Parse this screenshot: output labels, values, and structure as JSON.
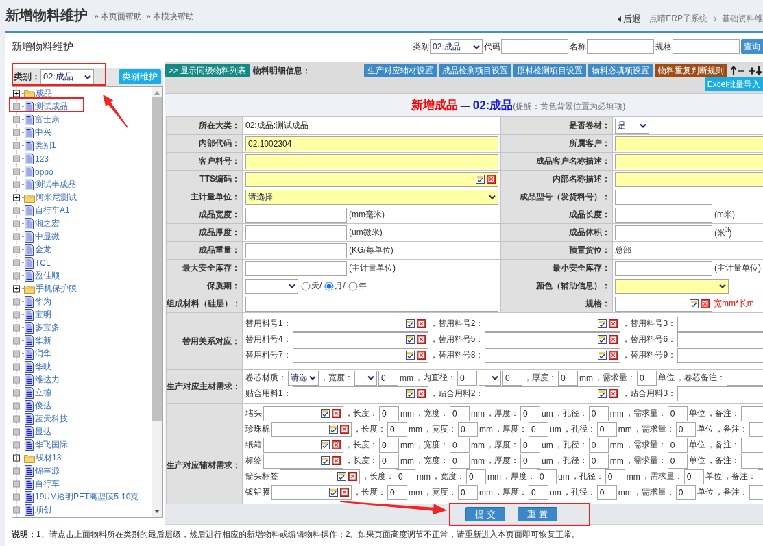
{
  "header": {
    "title": "新增物料维护",
    "links": [
      "» 本页面帮助",
      "» 本模块帮助"
    ],
    "back": "后退",
    "breadcrumb": [
      "点晴ERP子系统",
      "基础资料维"
    ]
  },
  "panel": {
    "title": "新增物料维护",
    "search": [
      {
        "kind": "select",
        "label": "类别",
        "value": "02:成品"
      },
      {
        "kind": "input",
        "label": "代码"
      },
      {
        "kind": "input",
        "label": "名称"
      },
      {
        "kind": "input",
        "label": "规格"
      }
    ],
    "search_button": "查询"
  },
  "category_filter": {
    "label": "类别：",
    "value": "02:成品",
    "button": "类别维护",
    "highlighted": true
  },
  "tree": [
    {
      "label": "成品",
      "kind": "folder",
      "expanded": false,
      "highlighted": false
    },
    {
      "label": "测试成品",
      "kind": "document",
      "highlighted": true
    },
    {
      "label": "富士康",
      "kind": "document",
      "highlighted": false
    },
    {
      "label": "中兴",
      "kind": "document",
      "highlighted": false
    },
    {
      "label": "类别1",
      "kind": "document",
      "highlighted": false
    },
    {
      "label": "123",
      "kind": "document",
      "highlighted": false
    },
    {
      "label": "oppo",
      "kind": "document",
      "highlighted": false
    },
    {
      "label": "测试半成品",
      "kind": "document",
      "highlighted": false
    },
    {
      "label": "阿米尼测试",
      "kind": "folder",
      "expanded": false,
      "highlighted": false
    },
    {
      "label": "自行车A1",
      "kind": "document",
      "highlighted": false
    },
    {
      "label": "湘之宏",
      "kind": "document",
      "highlighted": false
    },
    {
      "label": "中显微",
      "kind": "document",
      "highlighted": false
    },
    {
      "label": "金龙",
      "kind": "document",
      "highlighted": false
    },
    {
      "label": "TCL",
      "kind": "document",
      "highlighted": false
    },
    {
      "label": "盈佳顺",
      "kind": "document",
      "highlighted": false
    },
    {
      "label": "手机保护膜",
      "kind": "folder",
      "expanded": false,
      "highlighted": false
    },
    {
      "label": "华为",
      "kind": "document",
      "highlighted": false
    },
    {
      "label": "宝明",
      "kind": "document",
      "highlighted": false
    },
    {
      "label": "多宝多",
      "kind": "document",
      "highlighted": false
    },
    {
      "label": "华新",
      "kind": "document",
      "highlighted": false
    },
    {
      "label": "润华",
      "kind": "document",
      "highlighted": false
    },
    {
      "label": "华映",
      "kind": "document",
      "highlighted": false
    },
    {
      "label": "维达力",
      "kind": "document",
      "highlighted": false
    },
    {
      "label": "立德",
      "kind": "document",
      "highlighted": false
    },
    {
      "label": "俊达",
      "kind": "document",
      "highlighted": false
    },
    {
      "label": "蓝天科技",
      "kind": "document",
      "highlighted": false
    },
    {
      "label": "显达",
      "kind": "document",
      "highlighted": false
    },
    {
      "label": "华飞国际",
      "kind": "document",
      "highlighted": false
    },
    {
      "label": "线材13",
      "kind": "folder",
      "expanded": false,
      "highlighted": false
    },
    {
      "label": "锦丰源",
      "kind": "document",
      "highlighted": false
    },
    {
      "label": "自行车",
      "kind": "document",
      "highlighted": false
    },
    {
      "label": "19UM透明PET离型膜5-10克",
      "kind": "document",
      "highlighted": false
    },
    {
      "label": "顺创",
      "kind": "document",
      "highlighted": false
    }
  ],
  "toolbar": {
    "toggle_button": ">> 显示同级物料列表",
    "label": "物料明细信息：",
    "buttons": [
      {
        "label": "生产对应辅材设置",
        "kind": "primary"
      },
      {
        "label": "成品检测项目设置",
        "kind": "primary"
      },
      {
        "label": "原材检测项目设置",
        "kind": "primary"
      },
      {
        "label": "物料必填项设置",
        "kind": "primary"
      },
      {
        "label": "物料重复判断规则",
        "kind": "warning"
      }
    ],
    "import_button": "Excel批量导入"
  },
  "form": {
    "title": "新增成品",
    "separator": "—",
    "category": "02:成品",
    "hint": "(提醒：黄色背景位置为必填项)",
    "rows": [
      [
        {
          "label": "所在大类：",
          "kind": "text",
          "value": "02:成品:测试成品"
        },
        {
          "label": "是否卷材：",
          "kind": "select_short",
          "value": "是",
          "required": false
        }
      ],
      [
        {
          "label": "内部代码：",
          "kind": "input",
          "value": "02.1002304",
          "required": true
        },
        {
          "label": "所属客户：",
          "kind": "input",
          "required": true
        }
      ],
      [
        {
          "label": "客户料号：",
          "kind": "input",
          "required": true
        },
        {
          "label": "成品客户名称描述：",
          "kind": "input",
          "required": true
        }
      ],
      [
        {
          "label": "TTS编码：",
          "kind": "picker",
          "required": true
        },
        {
          "label": "内部名称描述：",
          "kind": "input",
          "required": true
        }
      ],
      [
        {
          "label": "主计量单位：",
          "kind": "select",
          "value": "请选择",
          "required": true
        },
        {
          "label": "成品型号（发货料号）：",
          "kind": "input_short",
          "required": false
        }
      ],
      [
        {
          "label": "成品宽度：",
          "kind": "input_short",
          "unit": "(mm毫米)",
          "required": false
        },
        {
          "label": "成品长度：",
          "kind": "input_short",
          "unit": "(m米)",
          "required": false
        }
      ],
      [
        {
          "label": "成品厚度：",
          "kind": "input_short",
          "unit": "(um微米)",
          "required": false
        },
        {
          "label": "成品体积：",
          "kind": "input_short",
          "unit": "(米$^{3}$)",
          "required": false
        }
      ],
      [
        {
          "label": "成品重量：",
          "kind": "input_short",
          "unit": "(KG/每单位)",
          "required": false
        },
        {
          "label": "预置货位：",
          "kind": "text",
          "value": "总部"
        }
      ],
      [
        {
          "label": "最大安全库存：",
          "kind": "input_short",
          "unit": "(主计量单位)",
          "required": false
        },
        {
          "label": "最小安全库存：",
          "kind": "input_short",
          "unit": "(主计量单位)",
          "required": false
        }
      ],
      [
        {
          "label": "保质期：",
          "kind": "shelf_life",
          "options": [
            {
              "label": "天/",
              "selected": false
            },
            {
              "label": "月/",
              "selected": true
            },
            {
              "label": "年",
              "selected": false
            }
          ]
        },
        {
          "label": "颜色（辅助信息）：",
          "kind": "select_mid",
          "required": true
        }
      ],
      [
        {
          "label": "组成材料（硅层）：",
          "kind": "input",
          "required": false
        },
        {
          "label": "规格：",
          "kind": "picker_short",
          "note": "宽mm*长m",
          "required": false
        }
      ]
    ],
    "substitutes": {
      "label": "替用关系对应：",
      "lines": [
        [
          {
            "label": "替用料号1：",
            "kind": "picker"
          },
          {
            "label": "，替用料号2：",
            "kind": "picker"
          },
          {
            "label": "，替用料号3：",
            "kind": "input"
          }
        ],
        [
          {
            "label": "替用料号4：",
            "kind": "picker"
          },
          {
            "label": "，替用料号5：",
            "kind": "picker"
          },
          {
            "label": "，替用料号6：",
            "kind": "input"
          }
        ],
        [
          {
            "label": "替用料号7：",
            "kind": "picker"
          },
          {
            "label": "，替用料号8：",
            "kind": "picker"
          },
          {
            "label": "，替用料号9：",
            "kind": "input"
          }
        ]
      ]
    },
    "main_material": {
      "label": "生产对应主材需求：",
      "lines": [
        [
          {
            "kind": "text",
            "text": "卷芯材质："
          },
          {
            "kind": "select",
            "value": "请选"
          },
          {
            "kind": "text",
            "text": "，宽度："
          },
          {
            "kind": "select"
          },
          {
            "kind": "number",
            "value": "0"
          },
          {
            "kind": "unit",
            "text": "mm"
          },
          {
            "kind": "text",
            "text": "，内直径："
          },
          {
            "kind": "number",
            "value": "0"
          },
          {
            "kind": "select"
          },
          {
            "kind": "number",
            "value": "0"
          },
          {
            "kind": "text",
            "text": "，厚度："
          },
          {
            "kind": "number",
            "value": "0"
          },
          {
            "kind": "unit",
            "text": "mm"
          },
          {
            "kind": "text",
            "text": "，需求量："
          },
          {
            "kind": "number",
            "value": "0"
          },
          {
            "kind": "unit",
            "text": "单位"
          },
          {
            "kind": "text",
            "text": "，卷芯备注："
          },
          {
            "kind": "input"
          }
        ],
        [
          {
            "kind": "text",
            "text": "贴合用料1："
          },
          {
            "kind": "picker"
          },
          {
            "kind": "text",
            "text": "，贴合用料2："
          },
          {
            "kind": "picker"
          },
          {
            "kind": "text",
            "text": "，贴合用料3："
          },
          {
            "kind": "input"
          }
        ]
      ]
    },
    "aux_material": {
      "label": "生产对应辅材需求：",
      "rows": [
        {
          "name": "堵头",
          "fields": [
            {
              "label": "，长度：",
              "value": "0",
              "unit": "mm"
            },
            {
              "label": "，宽度：",
              "value": "0",
              "unit": "mm"
            },
            {
              "label": "，厚度：",
              "value": "0",
              "unit": "um"
            },
            {
              "label": "，孔径：",
              "value": "0",
              "unit": "mm"
            },
            {
              "label": "，需求量：",
              "value": "0",
              "unit": "单位"
            }
          ],
          "note_label": "，备注："
        },
        {
          "name": "珍珠棉",
          "fields": [
            {
              "label": "，长度：",
              "value": "0",
              "unit": "mm"
            },
            {
              "label": "，宽度：",
              "value": "0",
              "unit": "mm"
            },
            {
              "label": "，厚度：",
              "value": "0",
              "unit": "um"
            },
            {
              "label": "，孔径：",
              "value": "0",
              "unit": "mm"
            },
            {
              "label": "，需求量：",
              "value": "0",
              "unit": "单位"
            }
          ],
          "note_label": "，备注："
        },
        {
          "name": "纸箱",
          "fields": [
            {
              "label": "，长度：",
              "value": "0",
              "unit": "mm"
            },
            {
              "label": "，宽度：",
              "value": "0",
              "unit": "mm"
            },
            {
              "label": "，厚度：",
              "value": "0",
              "unit": "um"
            },
            {
              "label": "，孔径：",
              "value": "0",
              "unit": "mm"
            },
            {
              "label": "，需求量：",
              "value": "0",
              "unit": "单位"
            }
          ],
          "note_label": "，备注："
        },
        {
          "name": "标签",
          "fields": [
            {
              "label": "，长度：",
              "value": "0",
              "unit": "mm"
            },
            {
              "label": "，宽度：",
              "value": "0",
              "unit": "mm"
            },
            {
              "label": "，厚度：",
              "value": "0",
              "unit": "um"
            },
            {
              "label": "，孔径：",
              "value": "0",
              "unit": "mm"
            },
            {
              "label": "，需求量：",
              "value": "0",
              "unit": "单位"
            }
          ],
          "note_label": "，备注："
        },
        {
          "name": "箭头标签",
          "fields": [
            {
              "label": "，长度：",
              "value": "0",
              "unit": "mm"
            },
            {
              "label": "，宽度：",
              "value": "0",
              "unit": "mm"
            },
            {
              "label": "，厚度：",
              "value": "0",
              "unit": "um"
            },
            {
              "label": "，孔径：",
              "value": "0",
              "unit": "mm"
            },
            {
              "label": "，需求量：",
              "value": "0",
              "unit": "单位"
            }
          ],
          "note_label": "，备注："
        },
        {
          "name": "镀铝膜",
          "fields": [
            {
              "label": "，长度：",
              "value": "0",
              "unit": "mm"
            },
            {
              "label": "，宽度：",
              "value": "0",
              "unit": "mm"
            },
            {
              "label": "，厚度：",
              "value": "0",
              "unit": "um"
            },
            {
              "label": "，孔径：",
              "value": "0",
              "unit": "mm"
            },
            {
              "label": "，需求量：",
              "value": "0",
              "unit": "单位"
            }
          ],
          "note_label": "，备注："
        }
      ]
    }
  },
  "actions": {
    "buttons": [
      "提 交",
      "重 置"
    ],
    "highlighted": true
  },
  "footer": "**说明：**1、请点击上面物料所在类别的最后层级，然后进行相应的新增物料或编辑物料操作；2、如果页面高度调节不正常，请重新进入本页面即可恢复正常。"
}
